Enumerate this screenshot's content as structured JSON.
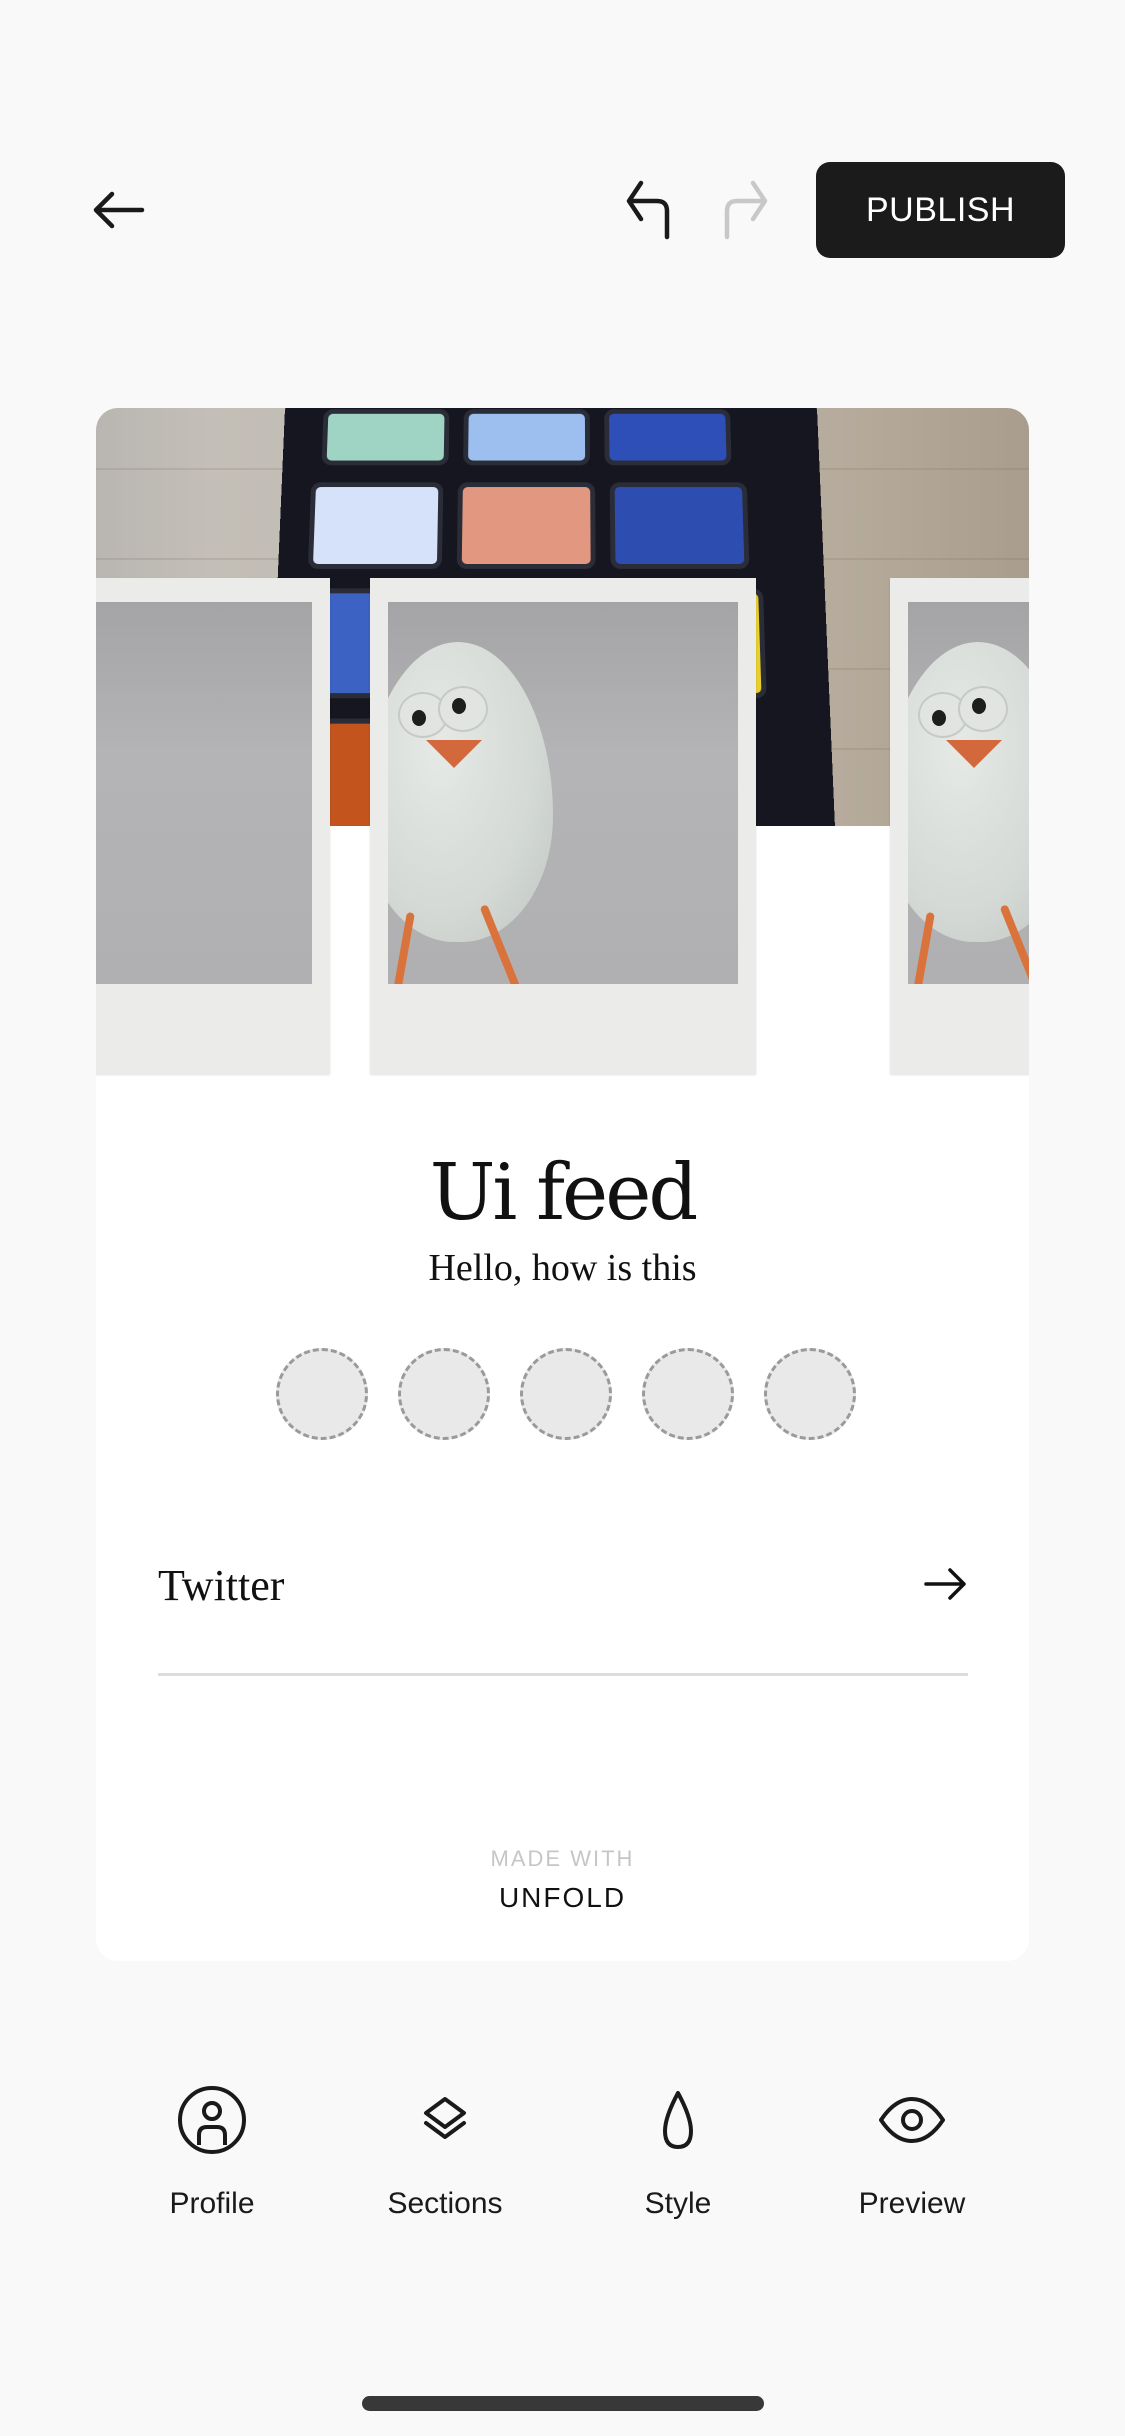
{
  "toolbar": {
    "back_icon": "arrow-left-icon",
    "undo_icon": "undo-icon",
    "redo_icon": "redo-icon",
    "redo_enabled": false,
    "publish_label": "PUBLISH"
  },
  "profile": {
    "cover_image": "rubiks-cube-on-wood-table",
    "gallery": [
      {
        "image": "egg-character-photo",
        "position": "left-partial"
      },
      {
        "image": "egg-character-photo",
        "position": "center"
      },
      {
        "image": "egg-character-photo",
        "position": "right-partial"
      }
    ],
    "name": "Ui feed",
    "bio": "Hello, how is this",
    "social_slots": 5
  },
  "links": [
    {
      "label": "Twitter",
      "icon": "arrow-right-icon"
    }
  ],
  "footer": {
    "made_with": "MADE WITH",
    "brand": "UNFOLD"
  },
  "bottom_nav": [
    {
      "label": "Profile",
      "icon": "profile-icon"
    },
    {
      "label": "Sections",
      "icon": "layers-icon"
    },
    {
      "label": "Style",
      "icon": "drop-icon"
    },
    {
      "label": "Preview",
      "icon": "eye-icon"
    }
  ],
  "colors": {
    "background": "#f9f9f9",
    "primary": "#1b1b1b",
    "disabled": "#c8c8c8",
    "card": "#ffffff",
    "slot_fill": "#e8e9e8"
  }
}
